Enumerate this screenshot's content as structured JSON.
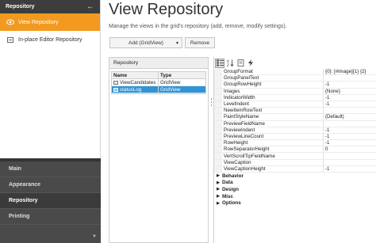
{
  "sidebar": {
    "header": "Repository",
    "items": [
      {
        "label": "View Repository",
        "icon": "view-icon",
        "active": true
      },
      {
        "label": "In-place Editor Repository",
        "icon": "editor-icon",
        "active": false
      }
    ],
    "categories": [
      {
        "label": "Main",
        "active": false
      },
      {
        "label": "Appearance",
        "active": false
      },
      {
        "label": "Repository",
        "active": true
      },
      {
        "label": "Printing",
        "active": false
      }
    ]
  },
  "main": {
    "title": "View Repository",
    "description": "Manage the views in the grid's repository (add, remove, modify settings).",
    "add_button": "Add (GridView)",
    "remove_button": "Remove"
  },
  "repository": {
    "title": "Repository",
    "columns": [
      "Name",
      "Type"
    ],
    "rows": [
      {
        "name": "ViewCandidates",
        "type": "GridView",
        "selected": false
      },
      {
        "name": "statusLog",
        "type": "GridView",
        "selected": true
      }
    ]
  },
  "properties": {
    "rows": [
      {
        "name": "GroupFormat",
        "value": "{0}: [#image]{1} {2}"
      },
      {
        "name": "GroupPanelText",
        "value": ""
      },
      {
        "name": "GroupRowHeight",
        "value": "-1"
      },
      {
        "name": "Images",
        "value": "(None)"
      },
      {
        "name": "IndicatorWidth",
        "value": "-1"
      },
      {
        "name": "LevelIndent",
        "value": "-1"
      },
      {
        "name": "NewItemRowText",
        "value": ""
      },
      {
        "name": "PaintStyleName",
        "value": "(Default)"
      },
      {
        "name": "PreviewFieldName",
        "value": ""
      },
      {
        "name": "PreviewIndent",
        "value": "-1"
      },
      {
        "name": "PreviewLineCount",
        "value": "-1"
      },
      {
        "name": "RowHeight",
        "value": "-1"
      },
      {
        "name": "RowSeparatorHeight",
        "value": "0"
      },
      {
        "name": "VertScrollTipFieldName",
        "value": ""
      },
      {
        "name": "ViewCaption",
        "value": ""
      },
      {
        "name": "ViewCaptionHeight",
        "value": "-1"
      }
    ],
    "categories": [
      "Behavior",
      "Data",
      "Design",
      "Misc",
      "Options"
    ]
  },
  "colors": {
    "accent": "#f29a1f",
    "selection": "#2f94d6",
    "sidebar_dark": "#4a4a4a"
  }
}
